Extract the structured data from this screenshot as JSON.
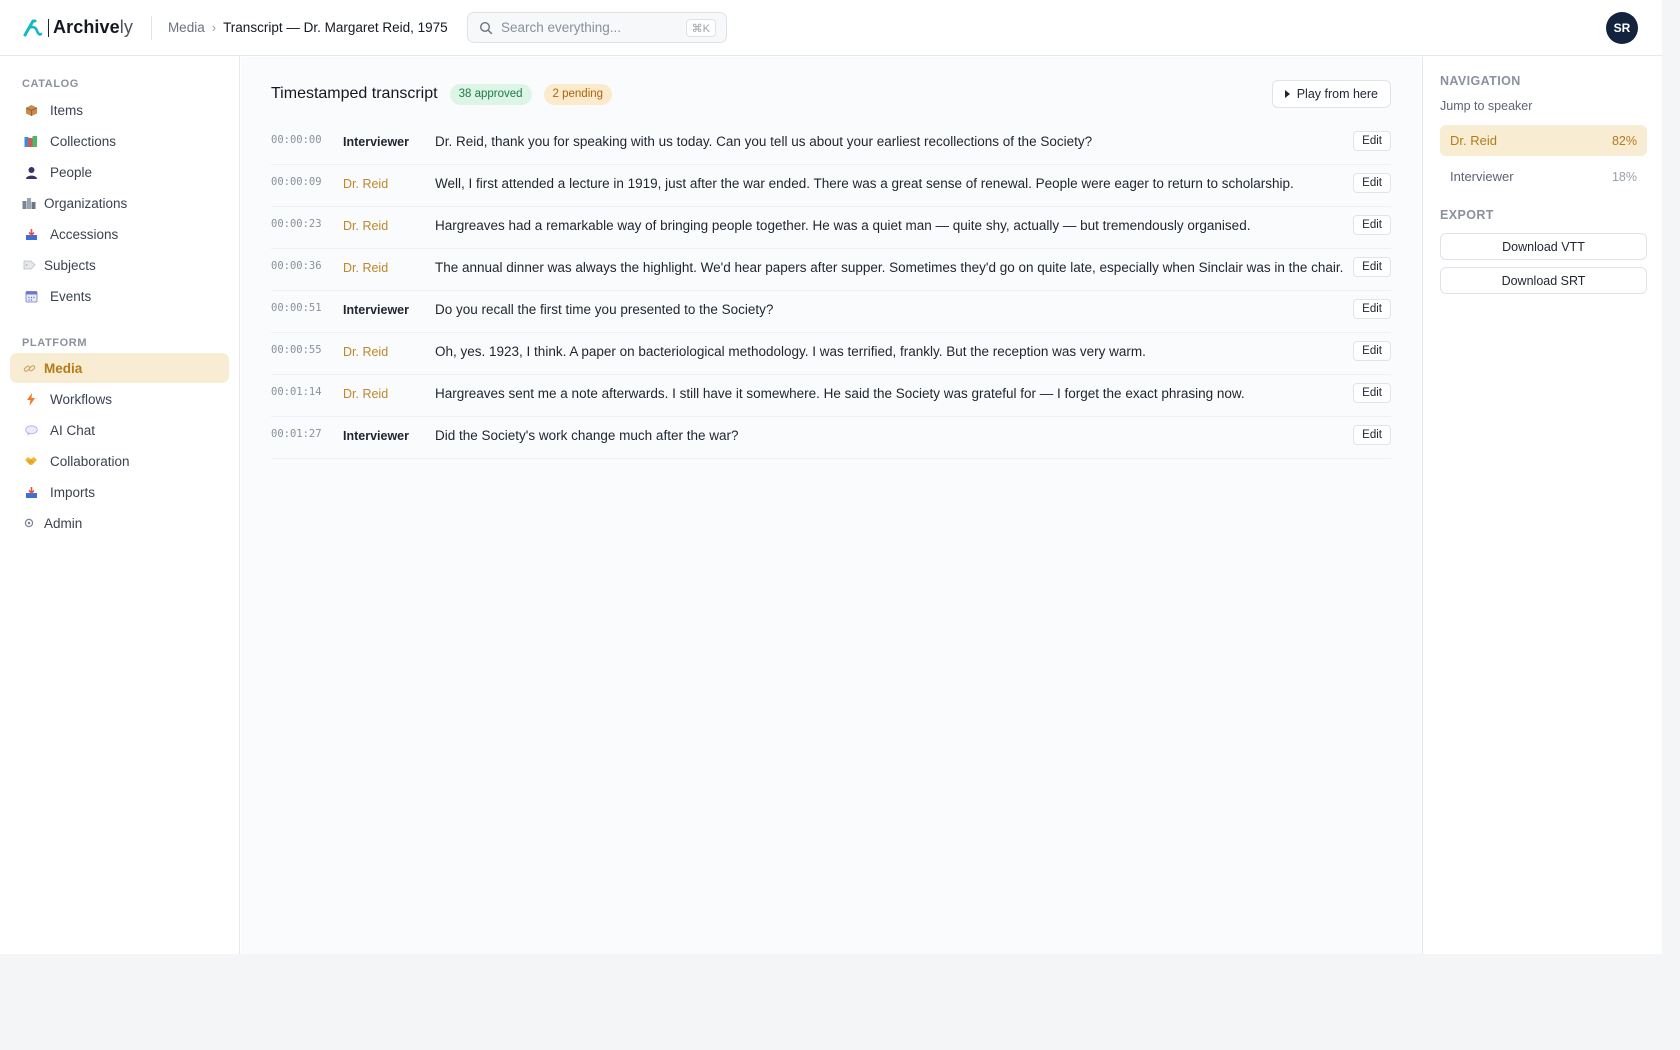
{
  "app": {
    "name_bold": "Archive",
    "name_light": "ly"
  },
  "header": {
    "breadcrumb": [
      "Media",
      "Transcript — Dr. Margaret Reid, 1975"
    ],
    "search": {
      "placeholder": "Search everything...",
      "shortcut": "⌘K"
    },
    "avatar_initials": "SR"
  },
  "sidebar": {
    "catalog_label": "CATALOG",
    "catalog_items": [
      {
        "label": "Items",
        "icon": "box-icon"
      },
      {
        "label": "Collections",
        "icon": "books-icon"
      },
      {
        "label": "People",
        "icon": "person-icon"
      },
      {
        "label": "Organizations",
        "icon": "building-icon"
      },
      {
        "label": "Accessions",
        "icon": "inbox-icon"
      },
      {
        "label": "Subjects",
        "icon": "tag-icon"
      },
      {
        "label": "Events",
        "icon": "calendar-icon"
      }
    ],
    "platform_label": "PLATFORM",
    "platform_items": [
      {
        "label": "Media",
        "icon": "link-icon",
        "active": true
      },
      {
        "label": "Workflows",
        "icon": "lightning-icon"
      },
      {
        "label": "AI Chat",
        "icon": "speech-bubble-icon"
      },
      {
        "label": "Collaboration",
        "icon": "handshake-icon"
      },
      {
        "label": "Imports",
        "icon": "inbox-tray-icon"
      },
      {
        "label": "Admin",
        "icon": "gear-icon"
      }
    ]
  },
  "transcript": {
    "title": "Timestamped transcript",
    "approved_badge": "38 approved",
    "pending_badge": "2 pending",
    "play_label": "Play from here",
    "edit_label": "Edit",
    "rows": [
      {
        "time": "00:00:00",
        "speaker": "Interviewer",
        "text": "Dr. Reid, thank you for speaking with us today. Can you tell us about your earliest recollections of the Society?"
      },
      {
        "time": "00:00:09",
        "speaker": "Dr. Reid",
        "text": "Well, I first attended a lecture in 1919, just after the war ended. There was a great sense of renewal. People were eager to return to scholarship."
      },
      {
        "time": "00:00:23",
        "speaker": "Dr. Reid",
        "text": "Hargreaves had a remarkable way of bringing people together. He was a quiet man — quite shy, actually — but tremendously organised."
      },
      {
        "time": "00:00:36",
        "speaker": "Dr. Reid",
        "text": "The annual dinner was always the highlight. We'd hear papers after supper. Sometimes they'd go on quite late, especially when Sinclair was in the chair."
      },
      {
        "time": "00:00:51",
        "speaker": "Interviewer",
        "text": "Do you recall the first time you presented to the Society?"
      },
      {
        "time": "00:00:55",
        "speaker": "Dr. Reid",
        "text": "Oh, yes. 1923, I think. A paper on bacteriological methodology. I was terrified, frankly. But the reception was very warm."
      },
      {
        "time": "00:01:14",
        "speaker": "Dr. Reid",
        "text": "Hargreaves sent me a note afterwards. I still have it somewhere. He said the Society was grateful for — I forget the exact phrasing now."
      },
      {
        "time": "00:01:27",
        "speaker": "Interviewer",
        "text": "Did the Society's work change much after the war?"
      }
    ]
  },
  "navigation_panel": {
    "heading": "NAVIGATION",
    "subheading": "Jump to speaker",
    "speakers": [
      {
        "name": "Dr. Reid",
        "percent": "82%",
        "active": true
      },
      {
        "name": "Interviewer",
        "percent": "18%"
      }
    ],
    "export_heading": "EXPORT",
    "download_vtt": "Download VTT",
    "download_srt": "Download SRT"
  },
  "colors": {
    "accent": "#b47b1c",
    "accent_bg": "#f8ecd2",
    "logo_teal": "#14b8c7",
    "avatar_bg": "#13233d"
  }
}
